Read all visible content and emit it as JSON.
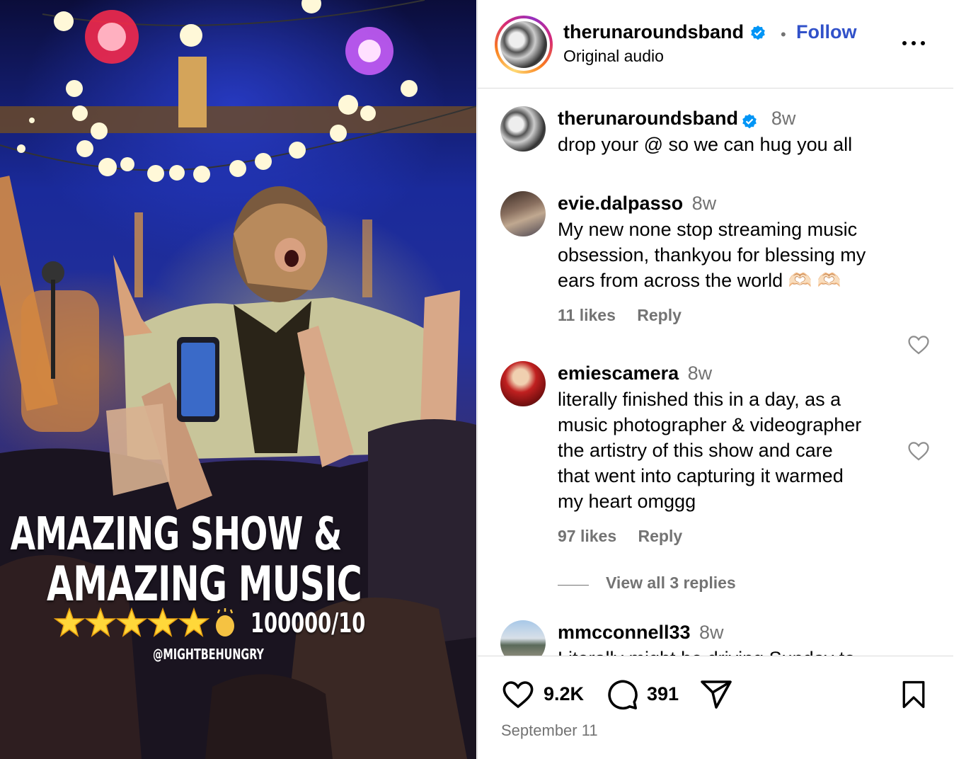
{
  "media": {
    "overlay_line1": "AMAZING SHOW &",
    "overlay_line2": "AMAZING MUSIC",
    "rating": "100000/10",
    "credit": "@MIGHTBEHUNGRY"
  },
  "header": {
    "username": "therunaroundsband",
    "separator": "•",
    "follow_label": "Follow",
    "audio_label": "Original audio"
  },
  "comments": [
    {
      "username": "therunaroundsband",
      "time": "8w",
      "text": "drop your @ so we can hug you all"
    },
    {
      "username": "evie.dalpasso",
      "time": "8w",
      "lines": [
        "My new none stop streaming music",
        "obsession, thankyou for blessing my",
        "ears from across the world 🫶🏻 🫶🏻"
      ],
      "likes": "11 likes",
      "reply": "Reply"
    },
    {
      "username": "emiescamera",
      "time": "8w",
      "lines": [
        "literally finished this in a day, as a",
        "music photographer & videographer",
        "the artistry of this show and care",
        "that went into capturing it warmed",
        "my heart omggg"
      ],
      "likes": "97 likes",
      "reply": "Reply",
      "view_replies": "View all 3 replies"
    },
    {
      "username": "mmcconnell33",
      "time": "8w",
      "text": "Literally might be driving Sunday to"
    }
  ],
  "actions": {
    "like_count": "9.2K",
    "comment_count": "391",
    "date": "September 11"
  },
  "colors": {
    "link_blue": "#3151c9",
    "verified_blue": "#0095f6",
    "muted": "#737373"
  }
}
